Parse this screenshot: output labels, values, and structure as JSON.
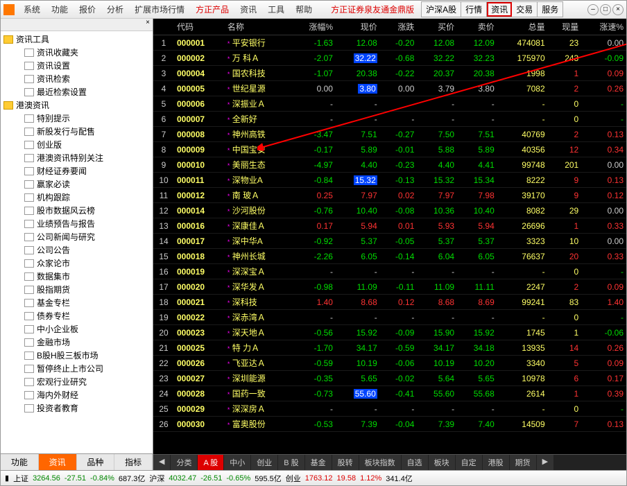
{
  "menubar": [
    "系统",
    "功能",
    "报价",
    "分析",
    "扩展市场行情",
    "方正产品",
    "资讯",
    "工具",
    "帮助"
  ],
  "banner": "方正证券泉友通金鼎版",
  "top_tabs": [
    "沪深A股",
    "行情",
    "资讯",
    "交易",
    "服务"
  ],
  "highlight_tab_index": 2,
  "sidebar": {
    "folders": [
      {
        "label": "资讯工具",
        "children": [
          "资讯收藏夹",
          "资讯设置",
          "资讯检索",
          "最近检索设置"
        ]
      },
      {
        "label": "港澳资讯",
        "children": [
          "特别提示",
          "新股发行与配售",
          "创业版",
          "港澳资讯特别关注",
          "财经证券要闻",
          "赢家必读",
          "机构跟踪",
          "股市数据风云榜",
          "业绩预告与报告",
          "公司新闻与研究",
          "公司公告",
          "众家论市",
          "数据集市",
          "股指期货",
          "基金专栏",
          "债券专栏",
          "中小企业板",
          "金融市场",
          "B股H股三板市场",
          "暂停终止上市公司",
          "宏观行业研究",
          "海内外财经",
          "投资者教育"
        ]
      }
    ],
    "tabs": [
      "功能",
      "资讯",
      "品种",
      "指标"
    ],
    "active_tab": 1
  },
  "columns": [
    "",
    "代码",
    "名称",
    "涨幅%",
    "现价",
    "涨跌",
    "买价",
    "卖价",
    "总量",
    "现量",
    "涨速%"
  ],
  "rows": [
    {
      "n": 1,
      "code": "000001",
      "name": "平安银行",
      "pct": "-1.63",
      "price": "12.08",
      "chg": "-0.20",
      "bid": "12.08",
      "ask": "12.09",
      "vol": "474081",
      "now": "23",
      "spd": "0.00",
      "dir": "d",
      "hl": false
    },
    {
      "n": 2,
      "code": "000002",
      "name": "万 科Ａ",
      "pct": "-2.07",
      "price": "32.22",
      "chg": "-0.68",
      "bid": "32.22",
      "ask": "32.23",
      "vol": "175970",
      "now": "243",
      "spd": "-0.09",
      "dir": "d",
      "hl": true
    },
    {
      "n": 3,
      "code": "000004",
      "name": "国农科技",
      "pct": "-1.07",
      "price": "20.38",
      "chg": "-0.22",
      "bid": "20.37",
      "ask": "20.38",
      "vol": "1998",
      "now": "1",
      "spd": "0.09",
      "dir": "d",
      "hl": false,
      "nowred": true
    },
    {
      "n": 4,
      "code": "000005",
      "name": "世纪星源",
      "pct": "0.00",
      "price": "3.80",
      "chg": "0.00",
      "bid": "3.79",
      "ask": "3.80",
      "vol": "7082",
      "now": "2",
      "spd": "0.26",
      "dir": "n",
      "hl": true,
      "nowred": true
    },
    {
      "n": 5,
      "code": "000006",
      "name": "深振业Ａ",
      "pct": "-",
      "price": "-",
      "chg": "-",
      "bid": "-",
      "ask": "-",
      "vol": "-",
      "now": "0",
      "spd": "-",
      "dir": "-"
    },
    {
      "n": 6,
      "code": "000007",
      "name": "全新好",
      "pct": "-",
      "price": "-",
      "chg": "-",
      "bid": "-",
      "ask": "-",
      "vol": "-",
      "now": "0",
      "spd": "-",
      "dir": "-"
    },
    {
      "n": 7,
      "code": "000008",
      "name": "神州高铁",
      "pct": "-3.47",
      "price": "7.51",
      "chg": "-0.27",
      "bid": "7.50",
      "ask": "7.51",
      "vol": "40769",
      "now": "2",
      "spd": "0.13",
      "dir": "d",
      "nowred": true
    },
    {
      "n": 8,
      "code": "000009",
      "name": "中国宝安",
      "pct": "-0.17",
      "price": "5.89",
      "chg": "-0.01",
      "bid": "5.88",
      "ask": "5.89",
      "vol": "40356",
      "now": "12",
      "spd": "0.34",
      "dir": "d",
      "nowred": true
    },
    {
      "n": 9,
      "code": "000010",
      "name": "美丽生态",
      "pct": "-4.97",
      "price": "4.40",
      "chg": "-0.23",
      "bid": "4.40",
      "ask": "4.41",
      "vol": "99748",
      "now": "201",
      "spd": "0.00",
      "dir": "d"
    },
    {
      "n": 10,
      "code": "000011",
      "name": "深物业A",
      "pct": "-0.84",
      "price": "15.32",
      "chg": "-0.13",
      "bid": "15.32",
      "ask": "15.34",
      "vol": "8222",
      "now": "9",
      "spd": "0.13",
      "dir": "d",
      "hl": true,
      "nowred": true
    },
    {
      "n": 11,
      "code": "000012",
      "name": "南 玻Ａ",
      "pct": "0.25",
      "price": "7.97",
      "chg": "0.02",
      "bid": "7.97",
      "ask": "7.98",
      "vol": "39170",
      "now": "9",
      "spd": "0.12",
      "dir": "u",
      "nowred": true
    },
    {
      "n": 12,
      "code": "000014",
      "name": "沙河股份",
      "pct": "-0.76",
      "price": "10.40",
      "chg": "-0.08",
      "bid": "10.36",
      "ask": "10.40",
      "vol": "8082",
      "now": "29",
      "spd": "0.00",
      "dir": "d"
    },
    {
      "n": 13,
      "code": "000016",
      "name": "深康佳Ａ",
      "pct": "0.17",
      "price": "5.94",
      "chg": "0.01",
      "bid": "5.93",
      "ask": "5.94",
      "vol": "26696",
      "now": "1",
      "spd": "0.33",
      "dir": "u",
      "nowred": true
    },
    {
      "n": 14,
      "code": "000017",
      "name": "深中华A",
      "pct": "-0.92",
      "price": "5.37",
      "chg": "-0.05",
      "bid": "5.37",
      "ask": "5.37",
      "vol": "3323",
      "now": "10",
      "spd": "0.00",
      "dir": "d"
    },
    {
      "n": 15,
      "code": "000018",
      "name": "神州长城",
      "pct": "-2.26",
      "price": "6.05",
      "chg": "-0.14",
      "bid": "6.04",
      "ask": "6.05",
      "vol": "76637",
      "now": "20",
      "spd": "0.33",
      "dir": "d",
      "nowred": true
    },
    {
      "n": 16,
      "code": "000019",
      "name": "深深宝Ａ",
      "pct": "-",
      "price": "-",
      "chg": "-",
      "bid": "-",
      "ask": "-",
      "vol": "-",
      "now": "0",
      "spd": "-",
      "dir": "-"
    },
    {
      "n": 17,
      "code": "000020",
      "name": "深华发Ａ",
      "pct": "-0.98",
      "price": "11.09",
      "chg": "-0.11",
      "bid": "11.09",
      "ask": "11.11",
      "vol": "2247",
      "now": "2",
      "spd": "0.09",
      "dir": "d",
      "nowred": true
    },
    {
      "n": 18,
      "code": "000021",
      "name": "深科技",
      "pct": "1.40",
      "price": "8.68",
      "chg": "0.12",
      "bid": "8.68",
      "ask": "8.69",
      "vol": "99241",
      "now": "83",
      "spd": "1.40",
      "dir": "u"
    },
    {
      "n": 19,
      "code": "000022",
      "name": "深赤湾Ａ",
      "pct": "-",
      "price": "-",
      "chg": "-",
      "bid": "-",
      "ask": "-",
      "vol": "-",
      "now": "0",
      "spd": "-",
      "dir": "-"
    },
    {
      "n": 20,
      "code": "000023",
      "name": "深天地Ａ",
      "pct": "-0.56",
      "price": "15.92",
      "chg": "-0.09",
      "bid": "15.90",
      "ask": "15.92",
      "vol": "1745",
      "now": "1",
      "spd": "-0.06",
      "dir": "d"
    },
    {
      "n": 21,
      "code": "000025",
      "name": "特 力Ａ",
      "pct": "-1.70",
      "price": "34.17",
      "chg": "-0.59",
      "bid": "34.17",
      "ask": "34.18",
      "vol": "13935",
      "now": "14",
      "spd": "0.26",
      "dir": "d",
      "nowred": true
    },
    {
      "n": 22,
      "code": "000026",
      "name": "飞亚达Ａ",
      "pct": "-0.59",
      "price": "10.19",
      "chg": "-0.06",
      "bid": "10.19",
      "ask": "10.20",
      "vol": "3340",
      "now": "5",
      "spd": "0.09",
      "dir": "d",
      "nowred": true
    },
    {
      "n": 23,
      "code": "000027",
      "name": "深圳能源",
      "pct": "-0.35",
      "price": "5.65",
      "chg": "-0.02",
      "bid": "5.64",
      "ask": "5.65",
      "vol": "10978",
      "now": "6",
      "spd": "0.17",
      "dir": "d",
      "nowred": true
    },
    {
      "n": 24,
      "code": "000028",
      "name": "国药一致",
      "pct": "-0.73",
      "price": "55.60",
      "chg": "-0.41",
      "bid": "55.60",
      "ask": "55.68",
      "vol": "2614",
      "now": "1",
      "spd": "0.39",
      "dir": "d",
      "hl": true,
      "nowred": true
    },
    {
      "n": 25,
      "code": "000029",
      "name": "深深房Ａ",
      "pct": "-",
      "price": "-",
      "chg": "-",
      "bid": "-",
      "ask": "-",
      "vol": "-",
      "now": "0",
      "spd": "-",
      "dir": "-"
    },
    {
      "n": 26,
      "code": "000030",
      "name": "富奥股份",
      "pct": "-0.53",
      "price": "7.39",
      "chg": "-0.04",
      "bid": "7.39",
      "ask": "7.40",
      "vol": "14509",
      "now": "7",
      "spd": "0.13",
      "dir": "d",
      "nowred": true
    }
  ],
  "bottom_tabs": [
    "分类",
    "A 股",
    "中小",
    "创业",
    "B 股",
    "基金",
    "股转",
    "板块指数",
    "自选",
    "板块",
    "自定",
    "港股",
    "期货"
  ],
  "status": {
    "sh_label": "上证",
    "sh_val": "3264.56",
    "sh_chg": "-27.51",
    "sh_pct": "-0.84%",
    "sh_vol": "687.3亿",
    "hs_label": "沪深",
    "hs_val": "4032.47",
    "hs_chg": "-26.51",
    "hs_pct": "-0.65%",
    "hs_vol": "595.5亿",
    "cy_label": "创业",
    "cy_val": "1763.12",
    "cy_chg": "19.58",
    "cy_pct": "1.12%",
    "cy_vol": "341.4亿"
  }
}
